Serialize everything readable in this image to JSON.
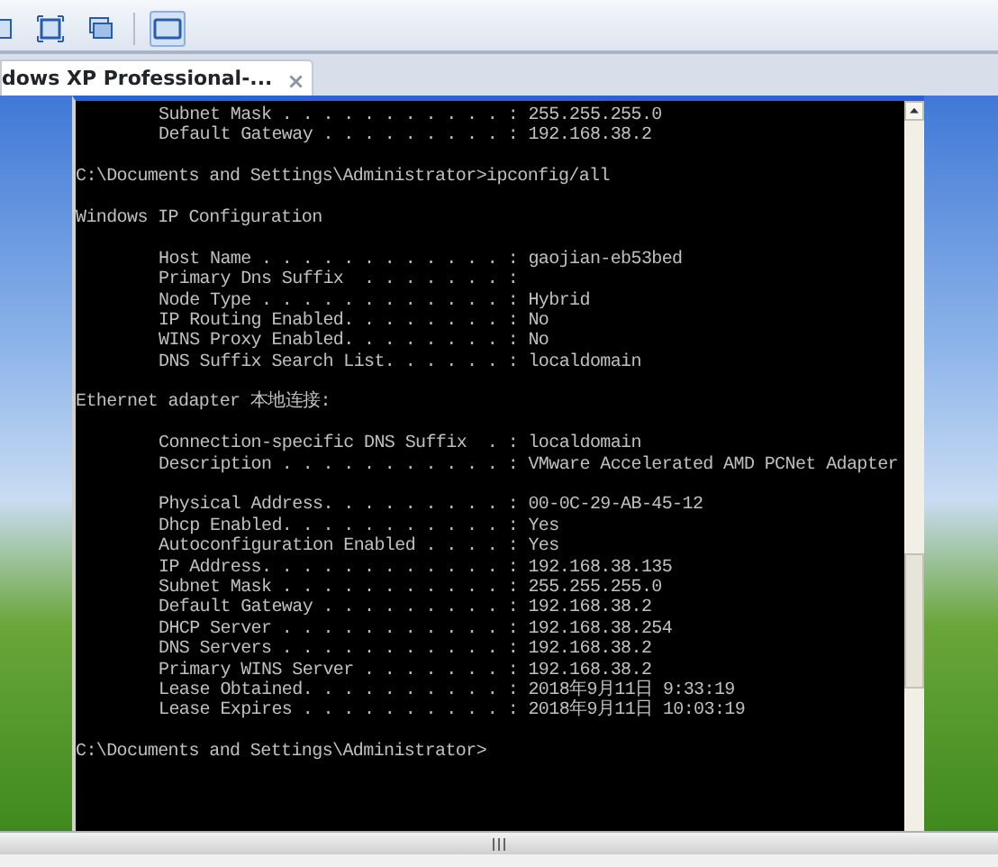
{
  "toolbar": {
    "buttons": [
      {
        "selected": false
      },
      {
        "selected": false
      },
      {
        "selected": false
      },
      {
        "selected": true
      }
    ]
  },
  "tabs": [
    {
      "label": "dows XP Professional-...",
      "close": "×",
      "selected": true
    }
  ],
  "console": {
    "lines": [
      {
        "kind": "field",
        "text": "Subnet Mask . . . . . . . . . . . : 255.255.255.0"
      },
      {
        "kind": "field",
        "text": "Default Gateway . . . . . . . . . : 192.168.38.2"
      },
      {
        "kind": "blank"
      },
      {
        "kind": "text",
        "text": "C:\\Documents and Settings\\Administrator>ipconfig/all"
      },
      {
        "kind": "blank"
      },
      {
        "kind": "text",
        "text": "Windows IP Configuration"
      },
      {
        "kind": "blank"
      },
      {
        "kind": "field",
        "text": "Host Name . . . . . . . . . . . . : gaojian-eb53bed"
      },
      {
        "kind": "field",
        "text": "Primary Dns Suffix  . . . . . . . :"
      },
      {
        "kind": "field",
        "text": "Node Type . . . . . . . . . . . . : Hybrid"
      },
      {
        "kind": "field",
        "text": "IP Routing Enabled. . . . . . . . : No"
      },
      {
        "kind": "field",
        "text": "WINS Proxy Enabled. . . . . . . . : No"
      },
      {
        "kind": "field",
        "text": "DNS Suffix Search List. . . . . . : localdomain"
      },
      {
        "kind": "blank"
      },
      {
        "kind": "text",
        "text": "Ethernet adapter 本地连接:"
      },
      {
        "kind": "blank"
      },
      {
        "kind": "field",
        "text": "Connection-specific DNS Suffix  . : localdomain"
      },
      {
        "kind": "field",
        "text": "Description . . . . . . . . . . . : VMware Accelerated AMD PCNet Adapter"
      },
      {
        "kind": "blank"
      },
      {
        "kind": "field",
        "text": "Physical Address. . . . . . . . . : 00-0C-29-AB-45-12"
      },
      {
        "kind": "field",
        "text": "Dhcp Enabled. . . . . . . . . . . : Yes"
      },
      {
        "kind": "field",
        "text": "Autoconfiguration Enabled . . . . : Yes"
      },
      {
        "kind": "field",
        "text": "IP Address. . . . . . . . . . . . : 192.168.38.135"
      },
      {
        "kind": "field",
        "text": "Subnet Mask . . . . . . . . . . . : 255.255.255.0"
      },
      {
        "kind": "field",
        "text": "Default Gateway . . . . . . . . . : 192.168.38.2"
      },
      {
        "kind": "field",
        "text": "DHCP Server . . . . . . . . . . . : 192.168.38.254"
      },
      {
        "kind": "field",
        "text": "DNS Servers . . . . . . . . . . . : 192.168.38.2"
      },
      {
        "kind": "field",
        "text": "Primary WINS Server . . . . . . . : 192.168.38.2"
      },
      {
        "kind": "field",
        "text": "Lease Obtained. . . . . . . . . . : 2018年9月11日 9:33:19"
      },
      {
        "kind": "field",
        "text": "Lease Expires . . . . . . . . . . : 2018年9月11日 10:03:19"
      },
      {
        "kind": "blank"
      },
      {
        "kind": "text",
        "text": "C:\\Documents and Settings\\Administrator>"
      }
    ]
  }
}
